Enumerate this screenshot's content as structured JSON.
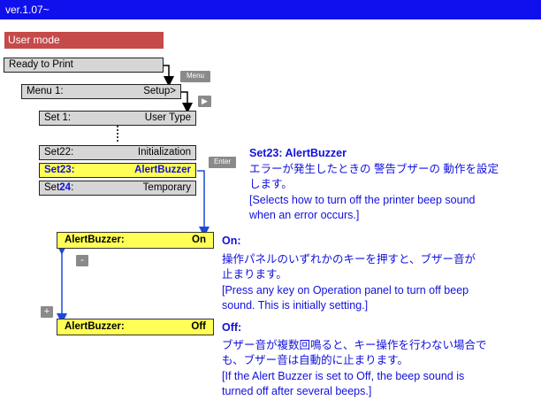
{
  "version": "ver.1.07~",
  "mode": "User mode",
  "screens": {
    "ready": "Ready to Print",
    "menu_left": "Menu   1:",
    "menu_right": "Setup>",
    "set1_left": "Set  1:",
    "set1_right": "User Type",
    "set22_left": "Set22:",
    "set22_right": "Initialization",
    "set23_left": "Set23:",
    "set23_right": "AlertBuzzer",
    "set24_prefix": "Set",
    "set24_num": "24",
    "set24_suffix": ":",
    "set24_right": "Temporary",
    "on_left": "AlertBuzzer:",
    "on_right": "On",
    "off_left": "AlertBuzzer:",
    "off_right": "Off"
  },
  "keys": {
    "menu": "Menu",
    "right": "▶",
    "enter": "Enter",
    "minus": "-",
    "plus": "+"
  },
  "desc": {
    "set23_title": "Set23: AlertBuzzer",
    "set23_jp1": "エラーが発生したときの 警告ブザーの 動作を設定",
    "set23_jp2": "します。",
    "set23_en1": "[Selects how to turn off the printer beep sound",
    "set23_en2": "when an error occurs.]",
    "on_title": "On:",
    "on_jp1": "操作パネルのいずれかのキーを押すと、ブザー音が",
    "on_jp2": "止まります。",
    "on_en1": "[Press any key on Operation panel to turn off beep",
    "on_en2": "sound. This is initially setting.]",
    "off_title": "Off:",
    "off_jp1": "ブザー音が複数回鳴ると、キー操作を行わない場合で",
    "off_jp2": "も、ブザー音は自動的に止まります。",
    "off_en1": "[If the Alert Buzzer is set to Off, the beep sound is",
    "off_en2": "turned off after several beeps.]"
  },
  "colors": {
    "header_blue": "#1010ee",
    "mode_red": "#c64a4a",
    "lcd_gray": "#d6d6d6",
    "highlight_yellow": "#ffff55",
    "text_blue": "#1010dd",
    "key_gray": "#8a8a8a"
  }
}
